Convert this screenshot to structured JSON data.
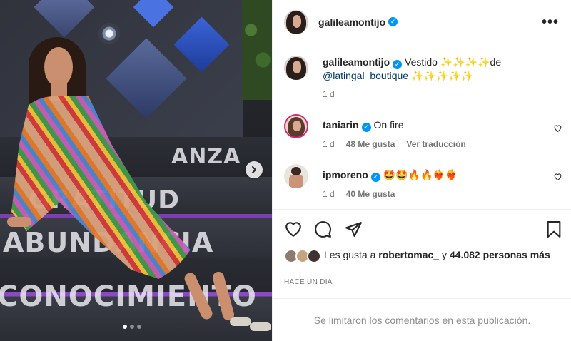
{
  "media": {
    "step_words": [
      "ANZA",
      "GRATITUD",
      "ABUNDANCIA",
      "CONOCIMIENTO"
    ],
    "carousel_dots": 3,
    "active_dot": 0
  },
  "header": {
    "username": "galileamontijo",
    "verified": true,
    "more_icon": "more-horizontal-icon"
  },
  "caption": {
    "username": "galileamontijo",
    "text_before_mention": " Vestido ✨✨✨✨de",
    "mention": "@latingal_boutique",
    "text_after_mention": " ✨✨✨✨✨",
    "time": "1 d"
  },
  "comments": [
    {
      "username": "taniarin",
      "verified": true,
      "text": " On fire",
      "time": "1 d",
      "likes": "48 Me gusta",
      "translate": "Ver traducción"
    },
    {
      "username": "ipmoreno",
      "verified": true,
      "text": " 🤩🤩🔥🔥❤️‍🔥❤️‍🔥",
      "time": "1 d",
      "likes": "40 Me gusta"
    }
  ],
  "likes": {
    "prefix": "Les gusta a ",
    "user": "robertomac_",
    "middle": " y ",
    "count": "44.082 personas más"
  },
  "timestamp": "HACE UN DÍA",
  "comments_limited": "Se limitaron los comentarios en esta publicación.",
  "colors": {
    "verified": "#0095f6",
    "link": "#00376b",
    "secondary_text": "#737373"
  }
}
